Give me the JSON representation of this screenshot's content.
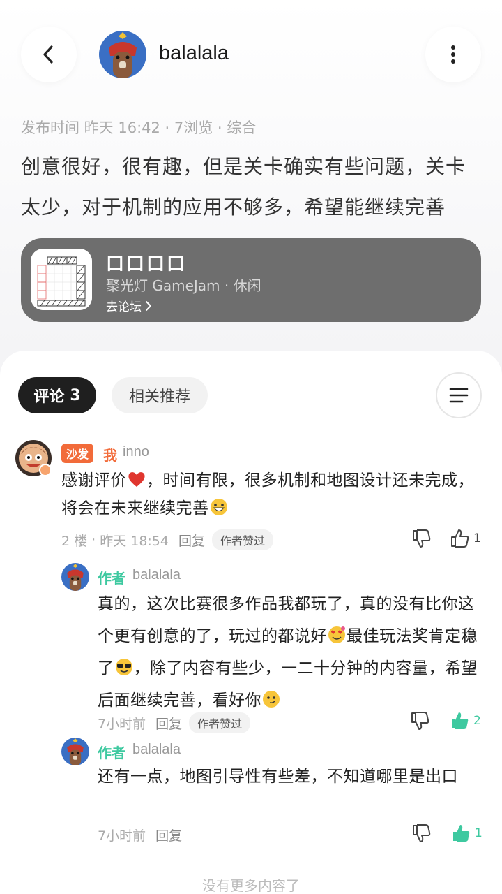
{
  "header": {
    "author": "balalala",
    "back_icon": "chevron-left-icon",
    "more_icon": "more-vertical-icon"
  },
  "post": {
    "meta": "发布时间 昨天 16:42 · 7浏览 · 综合",
    "text": "创意很好，很有趣，但是关卡确实有些问题，关卡太少，对于机制的应用不够多，希望能继续完善"
  },
  "game_card": {
    "title": "口口口口",
    "subtitle": "聚光灯 GameJam · 休闲",
    "link": "去论坛"
  },
  "tabs": {
    "comments_label": "评论",
    "comments_count": "3",
    "related_label": "相关推荐"
  },
  "comments": [
    {
      "badge": "沙发",
      "tag": "我",
      "user": "inno",
      "text_before": "感谢评价",
      "text_mid": "，时间有限，很多机制和地图设计还未完成，将会在未来继续完善",
      "floor": "2 楼",
      "time": "昨天 18:54",
      "reply": "回复",
      "liked_by_author": "作者赞过",
      "likes": "1"
    }
  ],
  "replies": [
    {
      "tag": "作者",
      "user": "balalala",
      "text_a": "真的，这次比赛很多作品我都玩了，真的没有比你这个更有创意的了，玩过的都说好",
      "text_b": "最佳玩法奖肯定稳了",
      "text_c": "，除了内容有些少，一二十分钟的内容量，希望后面继续完善，看好你",
      "time": "7小时前",
      "reply": "回复",
      "liked_by_author": "作者赞过",
      "likes": "2"
    },
    {
      "tag": "作者",
      "user": "balalala",
      "text": "还有一点，地图引导性有些差，不知道哪里是出口",
      "time": "7小时前",
      "reply": "回复",
      "likes": "1"
    }
  ],
  "footer": {
    "no_more": "没有更多内容了"
  },
  "colors": {
    "accent_orange": "#f26b3a",
    "accent_green": "#3ec9a0",
    "card_gray": "#6e6e6e"
  }
}
